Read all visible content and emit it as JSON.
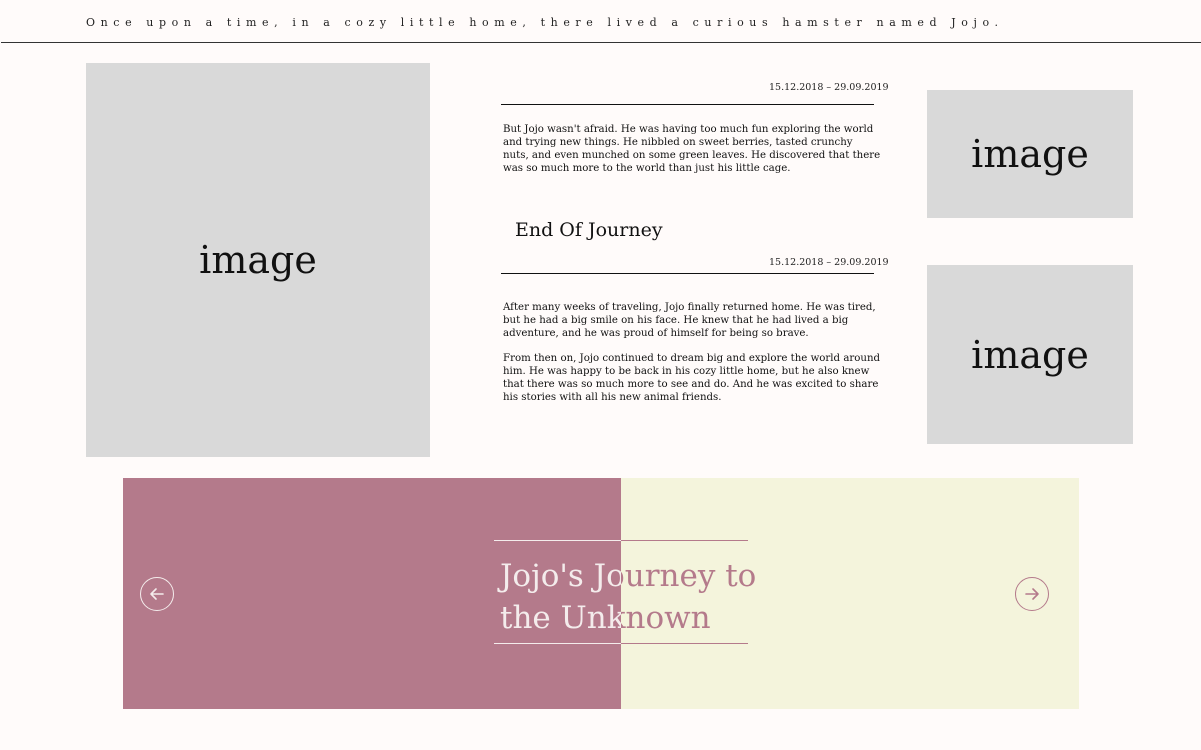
{
  "header": {
    "tagline": "Once upon a time, in a cozy little home, there lived a curious hamster named Jojo."
  },
  "images": {
    "hero": "image",
    "side_top": "image",
    "side_bottom": "image"
  },
  "entries": [
    {
      "date": "15.12.2018 – 29.09.2019",
      "paragraphs": [
        "But Jojo wasn't afraid. He was having too much fun exploring the world and trying new things. He nibbled on sweet berries, tasted crunchy nuts, and even munched on some green leaves. He discovered that there was so much more to the world than just his little cage."
      ]
    },
    {
      "title": "End Of Journey",
      "date": "15.12.2018 – 29.09.2019",
      "paragraphs": [
        "After many weeks of traveling, Jojo finally returned home. He was tired, but he had a big smile on his face. He knew that he had lived a big adventure, and he was proud of himself for being so brave.",
        "From then on, Jojo continued to dream big and explore the world around him. He was happy to be back in his cozy little home, but he also knew that there was so much more to see and do. And he was excited to share his stories with all his new animal friends."
      ]
    }
  ],
  "banner": {
    "title": "Jojo's Journey to the Unknown",
    "prev_icon": "arrow-left-icon",
    "next_icon": "arrow-right-icon"
  },
  "colors": {
    "background": "#fffbfa",
    "placeholder": "#d9d9d9",
    "mauve": "#b47a8b",
    "cream": "#f4f4dc",
    "light_text": "#f4ecec"
  }
}
